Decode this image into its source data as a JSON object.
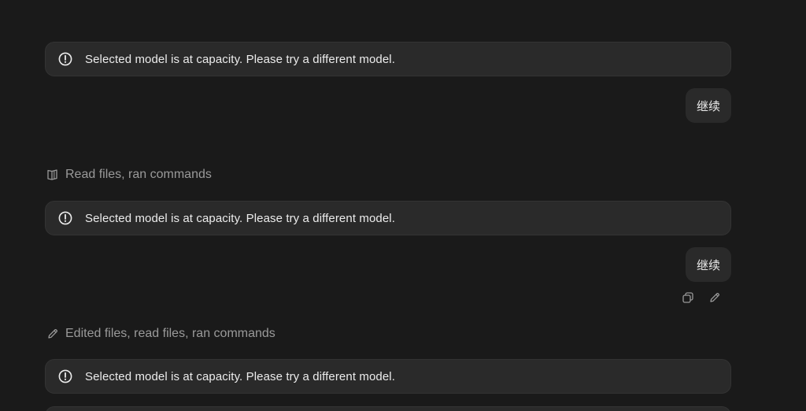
{
  "thread": {
    "errors": [
      {
        "text": "Selected model is at capacity. Please try a different model.",
        "icon": "alert-circle-icon"
      },
      {
        "text": "Selected model is at capacity. Please try a different model.",
        "icon": "alert-circle-icon"
      },
      {
        "text": "Selected model is at capacity. Please try a different model.",
        "icon": "alert-circle-icon"
      }
    ],
    "user_messages": [
      {
        "text": "继续"
      },
      {
        "text": "继续"
      }
    ],
    "activities": [
      {
        "text": "Read files, ran commands",
        "icon": "book-open-icon"
      },
      {
        "text": "Edited files, read files, ran commands",
        "icon": "pencil-icon"
      }
    ],
    "message_actions": [
      {
        "name": "copy",
        "icon": "copy-icon"
      },
      {
        "name": "edit",
        "icon": "pencil-icon"
      }
    ]
  },
  "colors": {
    "background": "#1a1a1a",
    "bubble": "#2a2a2a",
    "text": "#ececec",
    "muted": "#9a9a9a"
  }
}
